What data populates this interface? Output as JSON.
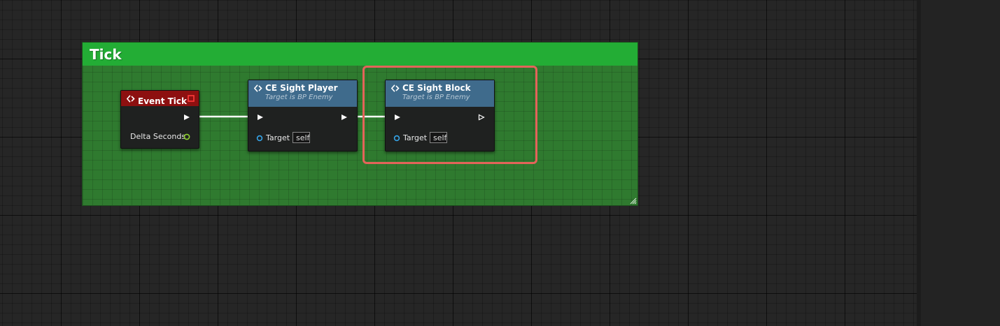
{
  "comment": {
    "title": "Tick"
  },
  "nodes": {
    "event_tick": {
      "title": "Event Tick",
      "pins": {
        "delta_seconds": "Delta Seconds"
      }
    },
    "ce_sight_player": {
      "title": "CE Sight Player",
      "subtitle": "Target is BP Enemy",
      "target_label": "Target",
      "target_value": "self"
    },
    "ce_sight_block": {
      "title": "CE Sight Block",
      "subtitle": "Target is BP Enemy",
      "target_label": "Target",
      "target_value": "self"
    }
  },
  "colors": {
    "comment_header": "#23ad35",
    "comment_body": "#2f7a2f",
    "event_header": "#8d1010",
    "function_header": "#3f6b8c",
    "highlight_border": "#e4645a",
    "float_pin": "#8fd12f",
    "object_pin": "#35a4e8"
  },
  "icons": {
    "function": "diamond-arrow-icon",
    "event_output": "red-square-icon",
    "exec_pin": "white-triangle-icon",
    "data_pin": "hollow-circle-icon"
  }
}
